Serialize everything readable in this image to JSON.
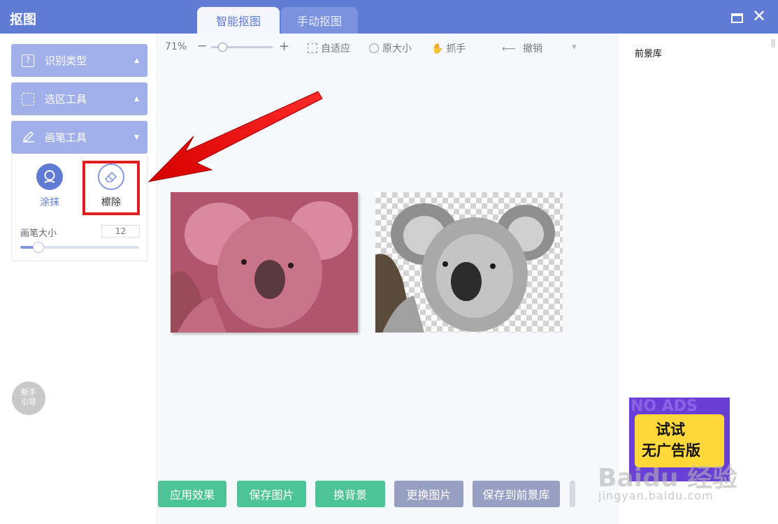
{
  "window": {
    "title": "抠图"
  },
  "tabs": [
    {
      "label": "智能抠图",
      "active": true
    },
    {
      "label": "手动抠图",
      "active": false
    }
  ],
  "left_panel": {
    "sections": [
      {
        "label": "识别类型",
        "icon": "question-box-icon"
      },
      {
        "label": "选区工具",
        "icon": "selection-icon"
      },
      {
        "label": "画笔工具",
        "icon": "pencil-icon"
      }
    ],
    "tools": [
      {
        "label": "涂抹",
        "icon": "smear-brush-icon"
      },
      {
        "label": "檫除",
        "icon": "eraser-icon"
      }
    ],
    "brush_size_label": "画笔大小",
    "brush_size_value": "12",
    "brush_slider_fraction": 0.15,
    "guide_label_line1": "新手",
    "guide_label_line2": "引导"
  },
  "toolbar": {
    "zoom_level": "71%",
    "zoom_minus": "−",
    "zoom_plus": "+",
    "fit_label": "自适应",
    "original_size_label": "原大小",
    "grab_label": "抓手",
    "undo_label": "撤销"
  },
  "bottom_buttons": [
    {
      "label": "应用效果",
      "style": "green"
    },
    {
      "label": "保存图片",
      "style": "green"
    },
    {
      "label": "换背景",
      "style": "green"
    },
    {
      "label": "更换图片",
      "style": "gray"
    },
    {
      "label": "保存到前景库",
      "style": "gray"
    }
  ],
  "right_panel": {
    "title": "前景库",
    "ad_ghost_text": "NO ADS",
    "ad_line1": "试试",
    "ad_line2": "无广告版"
  },
  "watermark": {
    "text": "Baidu 经验",
    "url": "jingyan.baidu.com"
  },
  "colors": {
    "brand": "#5f7bd3",
    "section_bg": "#a2b0ea",
    "green_button": "#4cc497",
    "gray_button": "#97a0c2",
    "annotation_red": "#e01e1e"
  }
}
